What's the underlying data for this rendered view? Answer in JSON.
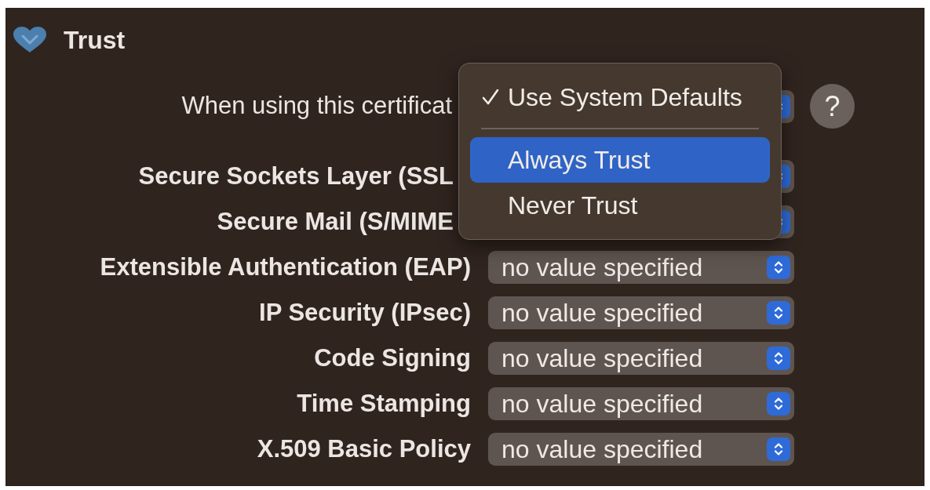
{
  "section": {
    "title": "Trust",
    "expanded": true
  },
  "default_row": {
    "label": "When using this certificat"
  },
  "help_button": {
    "label": "?"
  },
  "policies": [
    {
      "label": "Secure Sockets Layer (SSL"
    },
    {
      "label": "Secure Mail (S/MIME"
    },
    {
      "label": "Extensible Authentication (EAP)",
      "value": "no value specified"
    },
    {
      "label": "IP Security (IPsec)",
      "value": "no value specified"
    },
    {
      "label": "Code Signing",
      "value": "no value specified"
    },
    {
      "label": "Time Stamping",
      "value": "no value specified"
    },
    {
      "label": "X.509 Basic Policy",
      "value": "no value specified"
    }
  ],
  "menu": {
    "items": [
      {
        "kind": "option",
        "label": "Use System Defaults",
        "checked": true,
        "selected": false
      },
      {
        "kind": "separator"
      },
      {
        "kind": "option",
        "label": "Always Trust",
        "checked": false,
        "selected": true
      },
      {
        "kind": "option",
        "label": "Never Trust",
        "checked": false,
        "selected": false
      }
    ]
  }
}
